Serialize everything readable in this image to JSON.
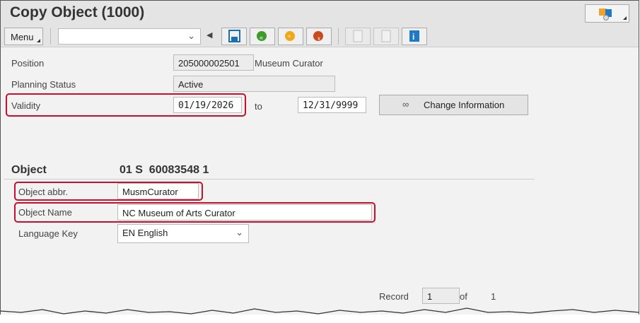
{
  "window": {
    "title": "Copy Object (1000)"
  },
  "toolbar": {
    "menu_label": "Menu",
    "command_field": "",
    "buttons": [
      "save",
      "back",
      "exit",
      "cancel",
      "previous",
      "next",
      "info"
    ]
  },
  "header": {
    "position_label": "Position",
    "position_id": "205000002501",
    "position_name": "Museum Curator",
    "planning_status_label": "Planning Status",
    "planning_status": "Active",
    "validity_label": "Validity",
    "validity_from": "01/19/2026",
    "to_label": "to",
    "validity_to": "12/31/9999",
    "change_info_label": "Change Information"
  },
  "object": {
    "heading": "Object",
    "key": "01 S  60083548 1",
    "abbr_label": "Object abbr.",
    "abbr": "MusmCurator",
    "name_label": "Object Name",
    "name": "NC Museum of Arts Curator",
    "lang_label": "Language Key",
    "lang": "EN English"
  },
  "record": {
    "label": "Record",
    "current": "1",
    "of_label": "of",
    "total": "1"
  },
  "colors": {
    "highlight": "#c8102e"
  }
}
